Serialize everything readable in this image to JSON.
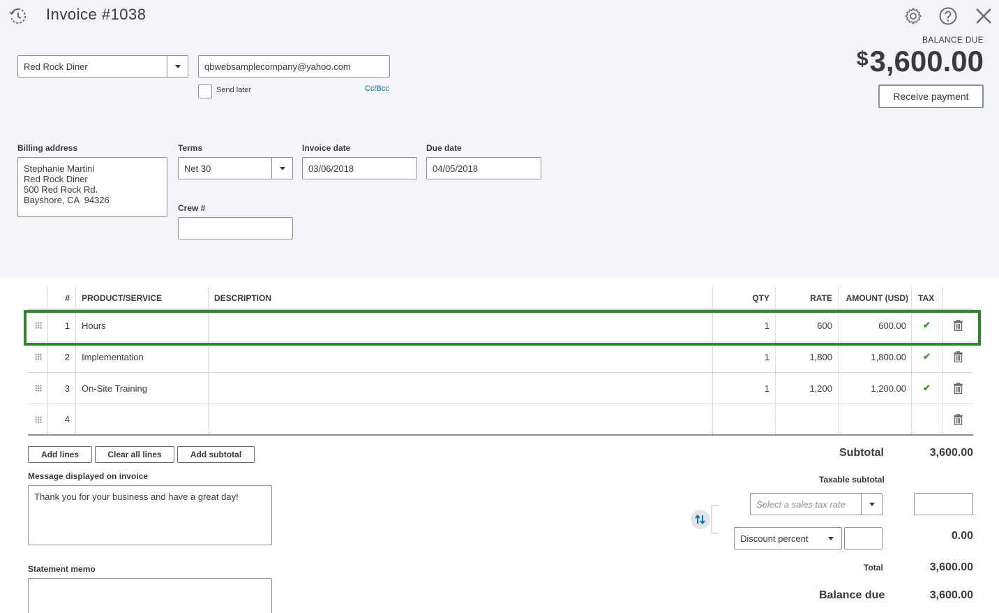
{
  "header": {
    "title": "Invoice #1038"
  },
  "customer": {
    "name": "Red Rock Diner",
    "email": "qbwebsamplecompany@yahoo.com",
    "send_later_label": "Send later",
    "cc_bcc_label": "Cc/Bcc"
  },
  "balance": {
    "label": "BALANCE DUE",
    "currency": "$",
    "amount": "3,600.00",
    "receive_payment_label": "Receive payment"
  },
  "billing": {
    "label": "Billing address",
    "lines": [
      "Stephanie Martini",
      "Red Rock Diner",
      "500 Red Rock Rd.",
      "Bayshore, CA  94326"
    ]
  },
  "terms": {
    "label": "Terms",
    "value": "Net 30"
  },
  "invoice_date": {
    "label": "Invoice date",
    "value": "03/06/2018"
  },
  "due_date": {
    "label": "Due date",
    "value": "04/05/2018"
  },
  "crew": {
    "label": "Crew #",
    "value": ""
  },
  "table": {
    "headers": {
      "num": "#",
      "product": "PRODUCT/SERVICE",
      "description": "DESCRIPTION",
      "qty": "QTY",
      "rate": "RATE",
      "amount": "AMOUNT (USD)",
      "tax": "TAX"
    },
    "rows": [
      {
        "num": "1",
        "product": "Hours",
        "description": "",
        "qty": "1",
        "rate": "600",
        "amount": "600.00",
        "tax": "✔"
      },
      {
        "num": "2",
        "product": "Implementation",
        "description": "",
        "qty": "1",
        "rate": "1,800",
        "amount": "1,800.00",
        "tax": "✔"
      },
      {
        "num": "3",
        "product": "On-Site Training",
        "description": "",
        "qty": "1",
        "rate": "1,200",
        "amount": "1,200.00",
        "tax": "✔"
      },
      {
        "num": "4",
        "product": "",
        "description": "",
        "qty": "",
        "rate": "",
        "amount": "",
        "tax": ""
      }
    ]
  },
  "buttons": {
    "add_lines": "Add lines",
    "clear_all_lines": "Clear all lines",
    "add_subtotal": "Add subtotal"
  },
  "message": {
    "label": "Message displayed on invoice",
    "value": "Thank you for your business and have a great day!"
  },
  "memo": {
    "label": "Statement memo",
    "value": ""
  },
  "summary": {
    "subtotal_label": "Subtotal",
    "subtotal_value": "3,600.00",
    "taxable_subtotal_label": "Taxable subtotal",
    "tax_rate_placeholder": "Select a sales tax rate",
    "discount_type": "Discount percent",
    "discount_value": "0.00",
    "total_label": "Total",
    "total_value": "3,600.00",
    "balance_due_label": "Balance due",
    "balance_due_value": "3,600.00"
  },
  "colors": {
    "highlight": "#2a8a2a",
    "check": "#2ca01c",
    "link": "#0077c5"
  }
}
